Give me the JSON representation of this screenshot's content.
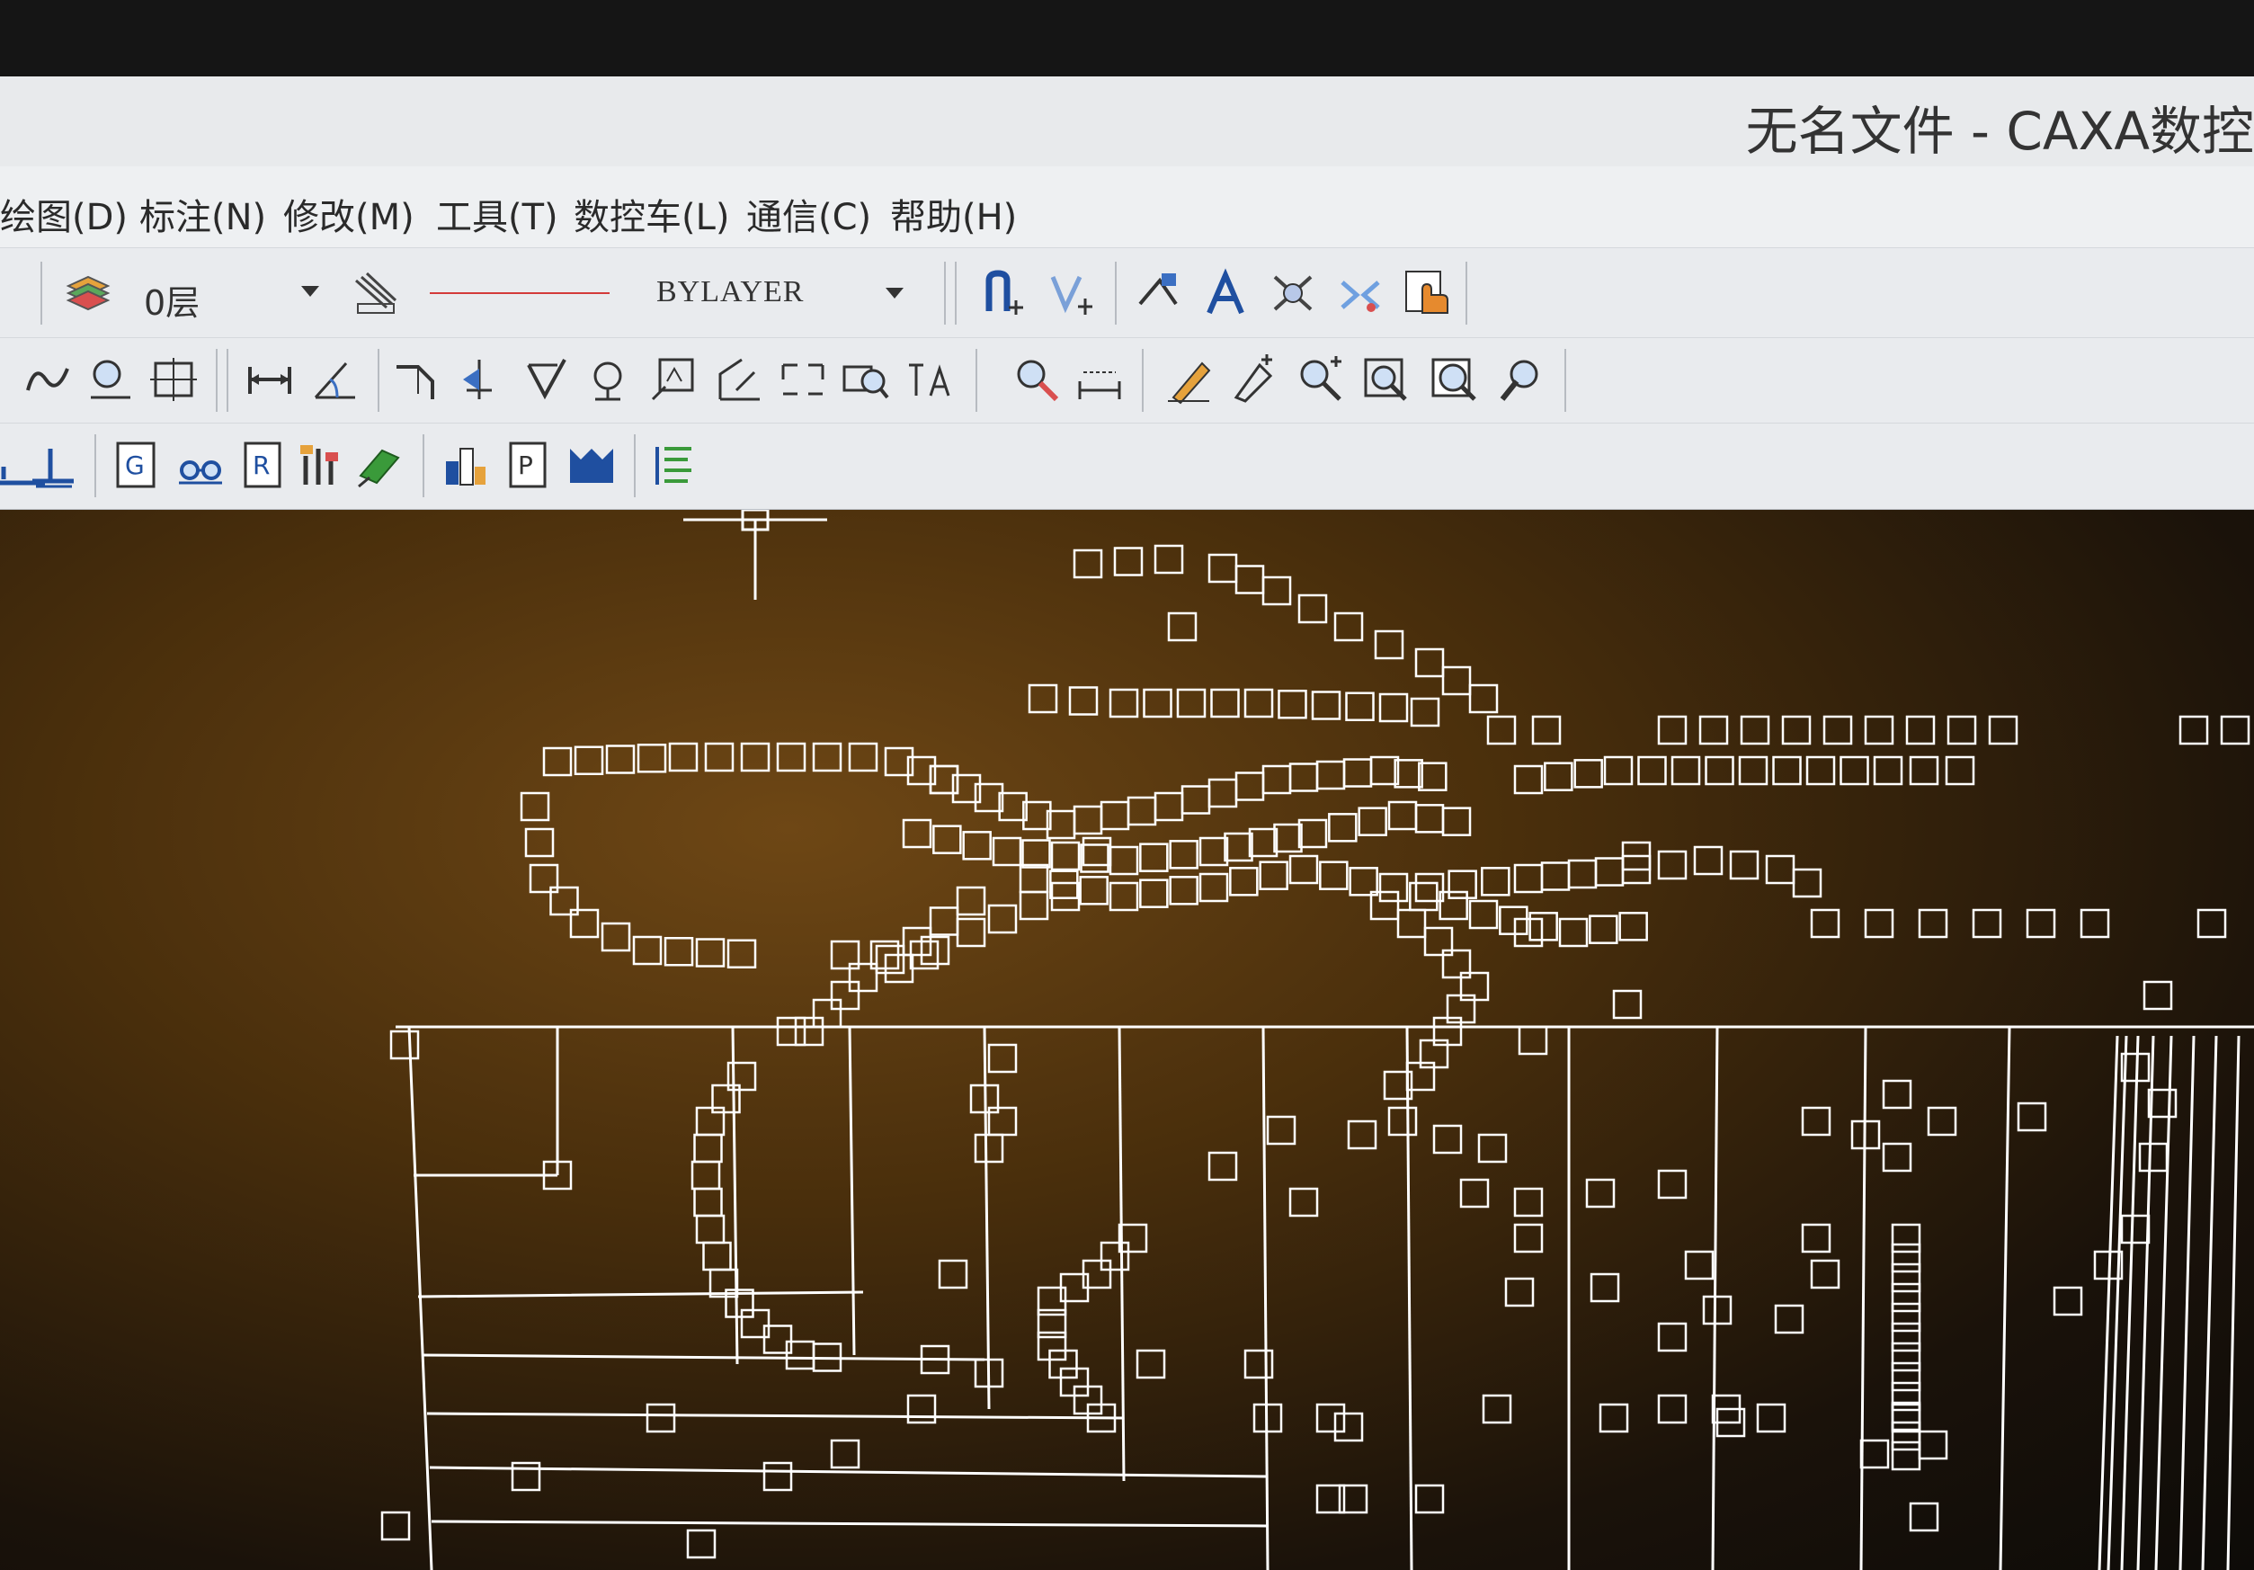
{
  "window": {
    "title": "无名文件 - CAXA数控"
  },
  "menu": {
    "items": [
      "绘图(D)",
      "标注(N)",
      "修改(M)",
      "工具(T)",
      "数控车(L)",
      "通信(C)",
      "帮助(H)"
    ]
  },
  "toolbar": {
    "layer_value": "0层",
    "linetype_value": "BYLAYER"
  },
  "colors": {
    "canvas_bg": "#4a2f0c",
    "drawing_lines": "#ffffff",
    "linetype_sample": "#d43a3a"
  }
}
